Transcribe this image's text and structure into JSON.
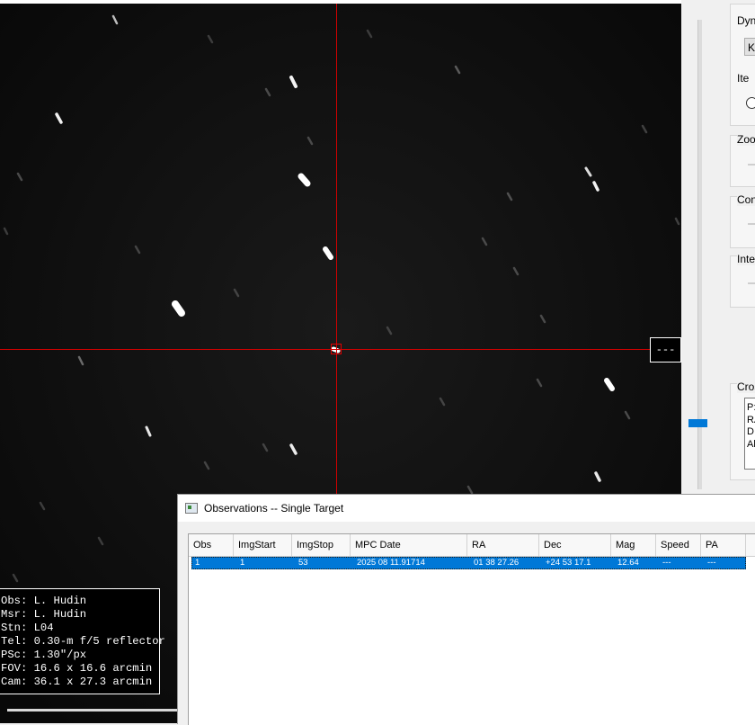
{
  "readout": {
    "value": "---"
  },
  "info": {
    "lines": [
      "Obs: L. Hudin",
      "Msr: L. Hudin",
      "Stn: L04",
      "Tel: 0.30-m f/5 reflector",
      "PSc: 1.30\"/px",
      "FOV: 16.6 x 16.6 arcmin",
      "Cam: 36.1 x 27.3 arcmin"
    ]
  },
  "panel": {
    "dyn_label": "Dyn",
    "dyn_button": "K-",
    "iter_label": "Ite",
    "zoom_label": "Zoo",
    "contrast_label": "Con",
    "intensity_label": "Inte",
    "cross_label": "Cros",
    "cross_lines": [
      "P:",
      "RA",
      "DI",
      "Al"
    ]
  },
  "observations": {
    "title": "Observations -- Single Target",
    "columns": [
      "Obs",
      "ImgStart",
      "ImgStop",
      "MPC Date",
      "RA",
      "Dec",
      "Mag",
      "Speed",
      "PA"
    ],
    "rows": [
      [
        "1",
        "1",
        "53",
        "2025 08 11.91714",
        "01 38 27.26",
        "+24 53 17.1",
        "12.64",
        "---",
        "---"
      ]
    ]
  },
  "colors": {
    "crosshair": "#d00000",
    "selection": "#0078d7"
  }
}
